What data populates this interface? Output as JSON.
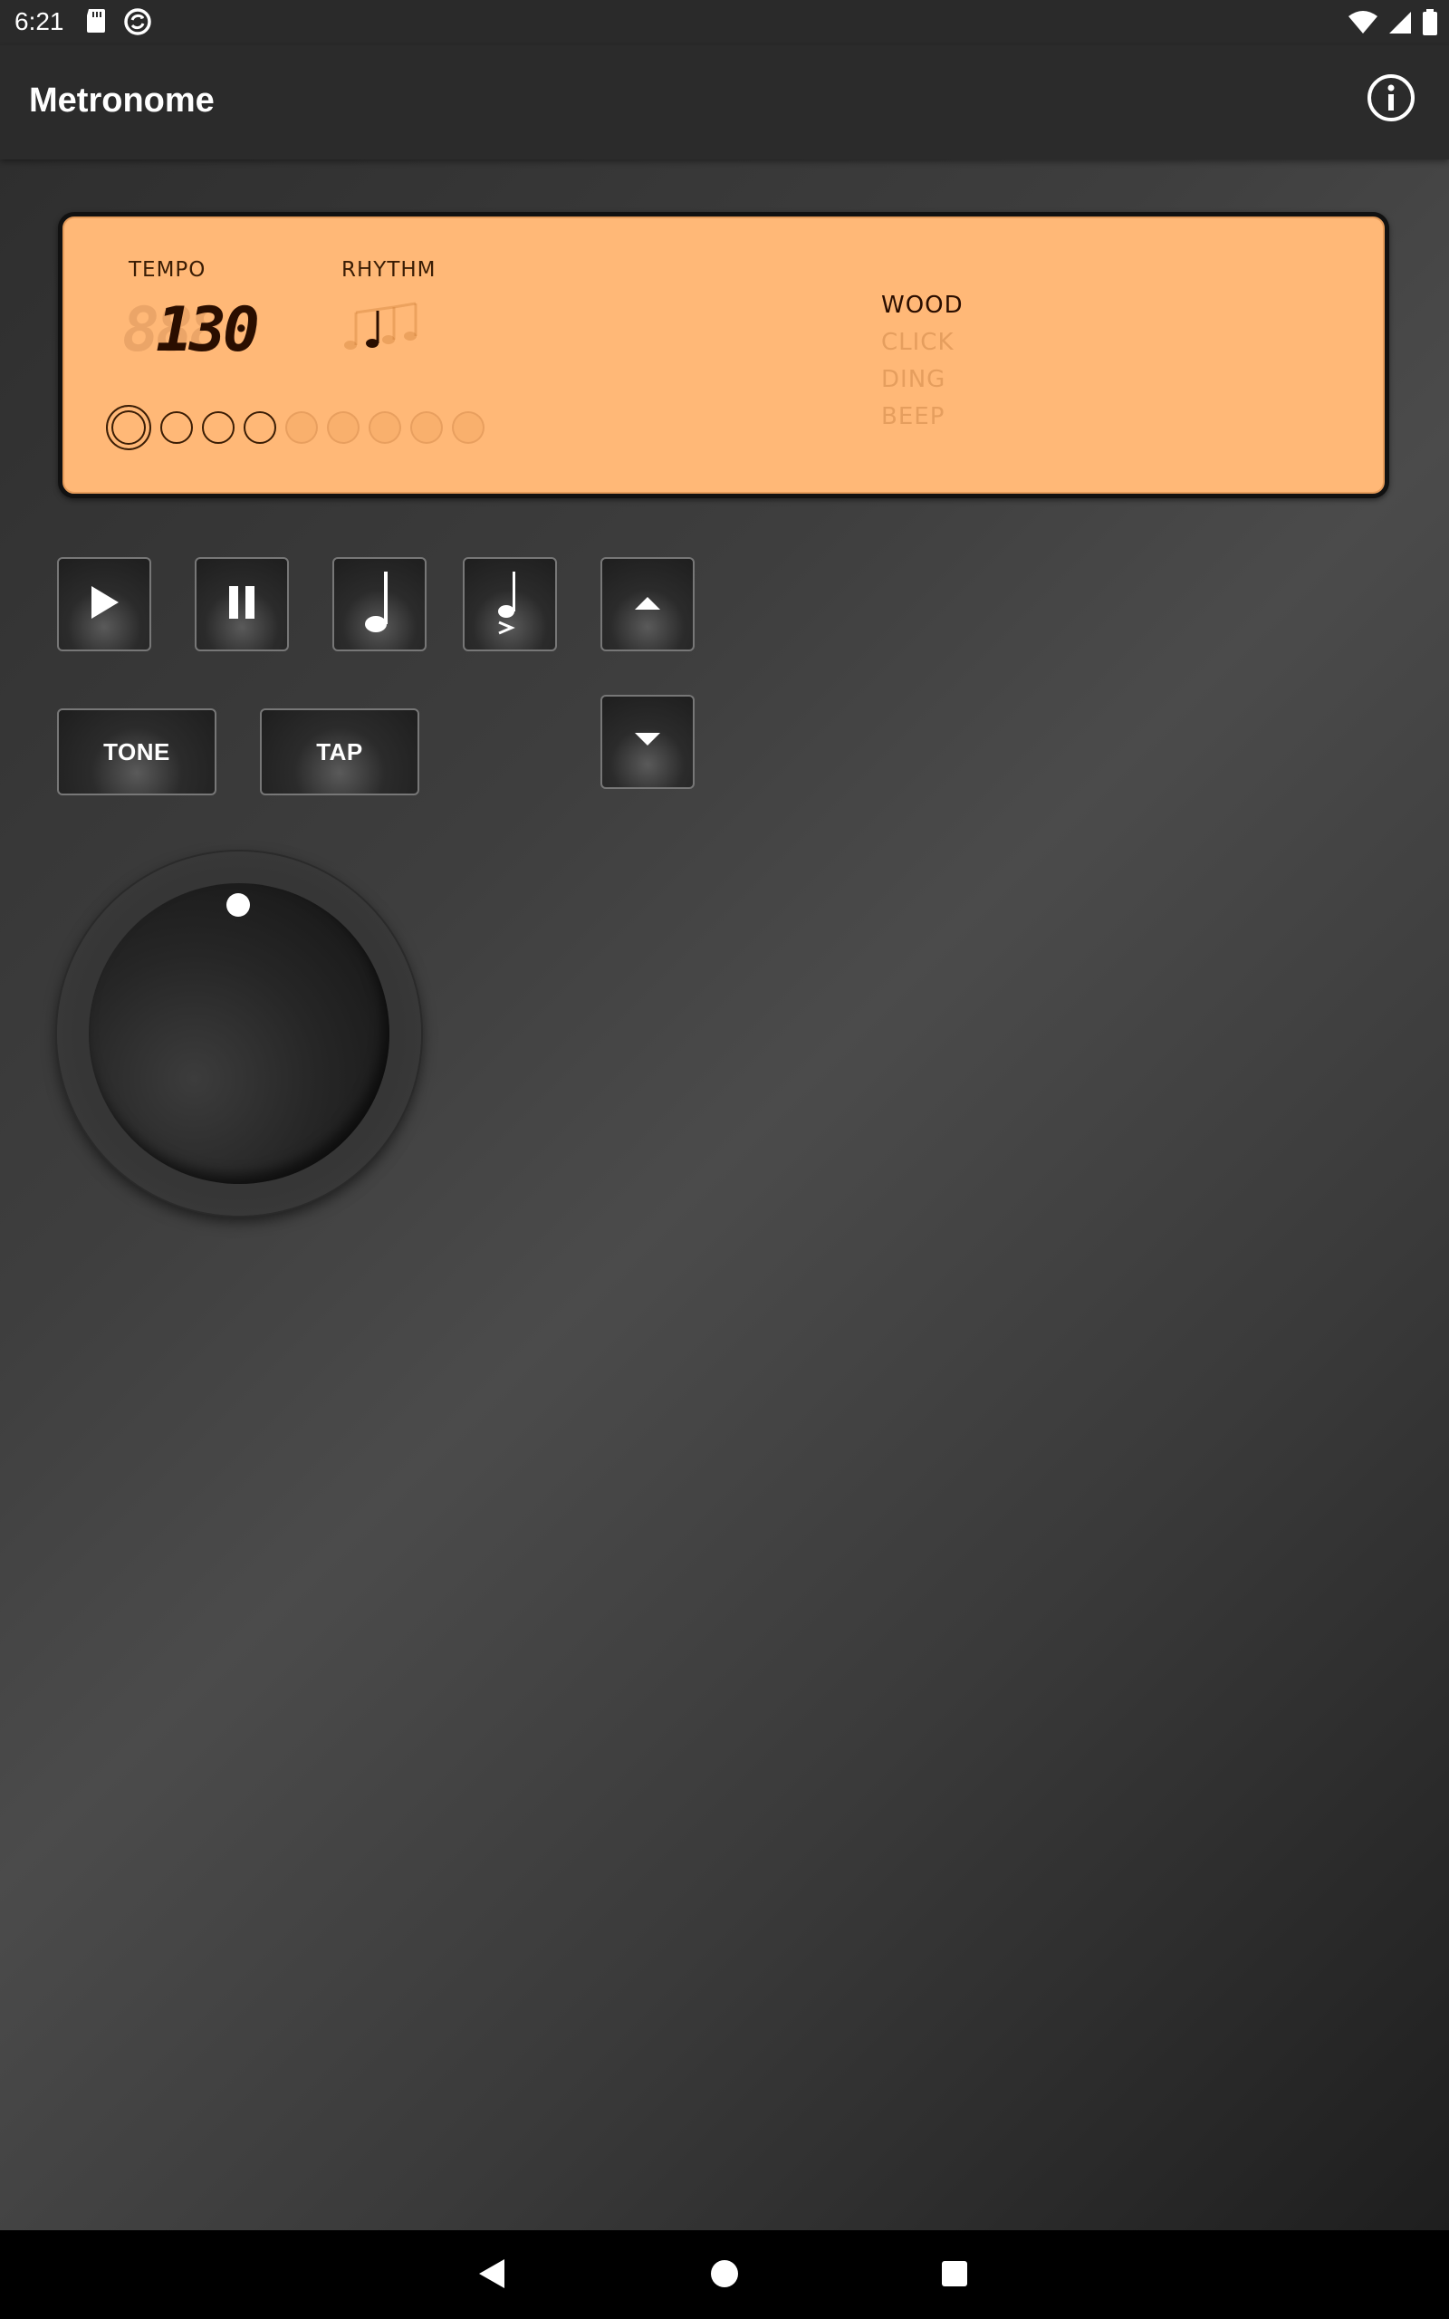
{
  "status_bar": {
    "time": "6:21"
  },
  "app_bar": {
    "title": "Metronome"
  },
  "display": {
    "tempo_label": "TEMPO",
    "tempo_value": "130",
    "rhythm_label": "RHYTHM",
    "sounds": [
      "WOOD",
      "CLICK",
      "DING",
      "BEEP"
    ],
    "selected_sound": "WOOD",
    "beats_total": 9,
    "beats_active": 4,
    "lcd_color": "#ffb877"
  },
  "controls": {
    "play_icon": "play-icon",
    "pause_icon": "pause-icon",
    "quarter_note_icon": "quarter-note-icon",
    "accent_note_icon": "accent-note-icon",
    "up_icon": "arrow-up-icon",
    "down_icon": "arrow-down-icon",
    "tone_label": "TONE",
    "tap_label": "TAP"
  },
  "colors": {
    "background_dark": "#1c1c1c",
    "app_bar": "#2b2b2b",
    "lcd_text": "#2a0e00"
  }
}
